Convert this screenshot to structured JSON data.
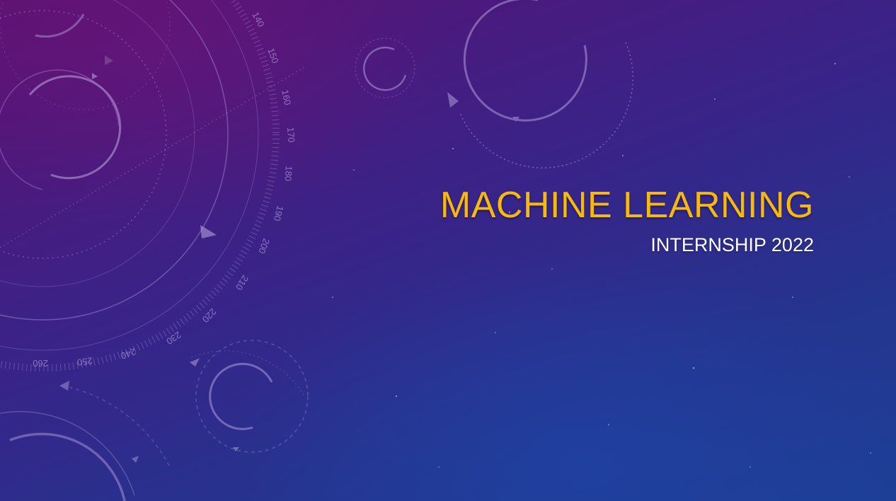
{
  "slide": {
    "title": "MACHINE LEARNING",
    "subtitle": "INTERNSHIP 2022"
  },
  "dial": {
    "labels": [
      "140",
      "150",
      "160",
      "170",
      "180",
      "190",
      "200",
      "210",
      "220",
      "230",
      "240",
      "250",
      "260"
    ]
  },
  "colors": {
    "title": "#f6b90d",
    "subtitle": "#ffffff",
    "background_top": "#5a1270",
    "background_bottom": "#1d3f96"
  }
}
